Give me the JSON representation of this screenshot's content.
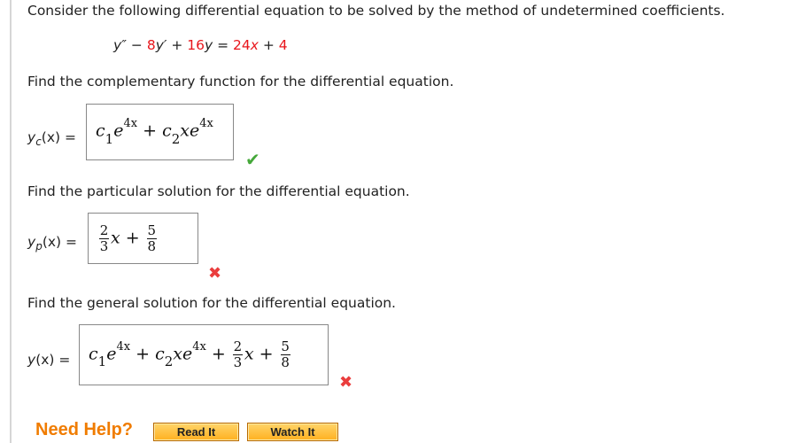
{
  "question_intro": "Consider the following differential equation to be solved by the method of undetermined coefficients.",
  "equation": {
    "y2": "y″",
    "minus": " − ",
    "coef1": "8",
    "y1": "y′",
    "plus1": " + ",
    "coef2": "16",
    "y0": "y",
    "equals": " = ",
    "rhs1": "24",
    "rhs_x": "x",
    "plus2": " + ",
    "rhs2": "4"
  },
  "parts": [
    {
      "prompt": "Find the complementary function for the differential equation.",
      "label_main": "y",
      "label_sub": "c",
      "label_rest": "(x) =",
      "answer": {
        "c1": "c",
        "n1": "1",
        "e1": "e",
        "exp1": "4x",
        "plus": "+",
        "c2": "c",
        "n2": "2",
        "x": "x",
        "e2": "e",
        "exp2": "4x"
      },
      "status": "correct",
      "status_icon": "check-icon"
    },
    {
      "prompt": "Find the particular solution for the differential equation.",
      "label_main": "y",
      "label_sub": "p",
      "label_rest": "(x) =",
      "answer": {
        "num1": "2",
        "den1": "3",
        "x": "x",
        "plus": "+",
        "num2": "5",
        "den2": "8"
      },
      "status": "incorrect",
      "status_icon": "cross-icon"
    },
    {
      "prompt": "Find the general solution for the differential equation.",
      "label_main": "y",
      "label_rest": "(x) =",
      "answer": {
        "c1": "c",
        "n1": "1",
        "e1": "e",
        "exp1": "4x",
        "plus1": "+",
        "c2": "c",
        "n2": "2",
        "x": "x",
        "e2": "e",
        "exp2": "4x",
        "plus2": "+",
        "num1": "2",
        "den1": "3",
        "x2": "x",
        "plus3": "+",
        "num2": "5",
        "den2": "8"
      },
      "status": "incorrect",
      "status_icon": "cross-icon"
    }
  ],
  "help": {
    "label": "Need Help?",
    "read_it": "Read It",
    "watch_it": "Watch It"
  },
  "colors": {
    "accent_red": "#e8151b",
    "correct_green": "#45a83a",
    "incorrect_red": "#ea3d3d",
    "help_orange": "#f07c00"
  }
}
